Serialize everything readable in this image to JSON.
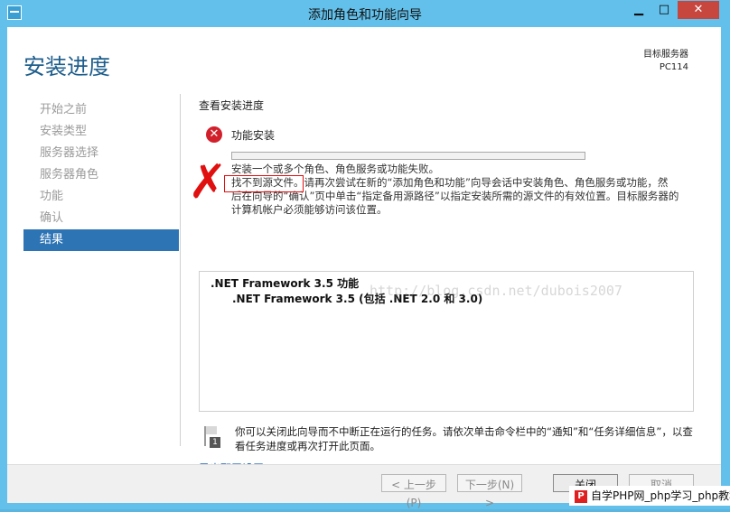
{
  "window": {
    "title": "添加角色和功能向导",
    "controls": {
      "minimize": "▁",
      "maximize": "□",
      "close": "✕"
    }
  },
  "header": {
    "heading": "安装进度",
    "target_label": "目标服务器",
    "target_value": "PC114"
  },
  "sidebar": {
    "items": [
      {
        "label": "开始之前",
        "active": false
      },
      {
        "label": "安装类型",
        "active": false
      },
      {
        "label": "服务器选择",
        "active": false
      },
      {
        "label": "服务器角色",
        "active": false
      },
      {
        "label": "功能",
        "active": false
      },
      {
        "label": "确认",
        "active": false
      },
      {
        "label": "结果",
        "active": true
      }
    ]
  },
  "main": {
    "section_title": "查看安装进度",
    "status": {
      "icon": "error-icon",
      "label": "功能安装"
    },
    "failure_lines": [
      "安装一个或多个角色、角色服务或功能失败。",
      "找不到源文件。请再次尝试在新的“添加角色和功能”向导会话中安装角色、角色服务或功能，然",
      "后在向导的“确认”页中单击“指定备用源路径”以指定安装所需的源文件的有效位置。目标服务器的",
      "计算机帐户必须能够访问该位置。"
    ],
    "results": {
      "feature": ".NET Framework 3.5 功能",
      "subfeature": ".NET Framework 3.5 (包括 .NET 2.0 和 3.0)"
    },
    "watermark": "http://blog.csdn.net/dubois2007",
    "notice": {
      "icon": "flag-notification-icon",
      "text": "你可以关闭此向导而不中断正在运行的任务。请依次单击命令栏中的“通知”和“任务详细信息”，以查看任务进度或再次打开此页面。"
    },
    "export_link": "导出配置设置"
  },
  "footer": {
    "prev": "< 上一步(P)",
    "next": "下一步(N) >",
    "close": "关闭",
    "cancel": "取消"
  },
  "overlay_badge": "自学PHP网_php学习_php教程",
  "colors": {
    "title_bar": "#63c0ea",
    "heading": "#1e5e8c",
    "active_nav": "#2d74b5",
    "error": "#d1202b",
    "link": "#1a5fb4"
  }
}
